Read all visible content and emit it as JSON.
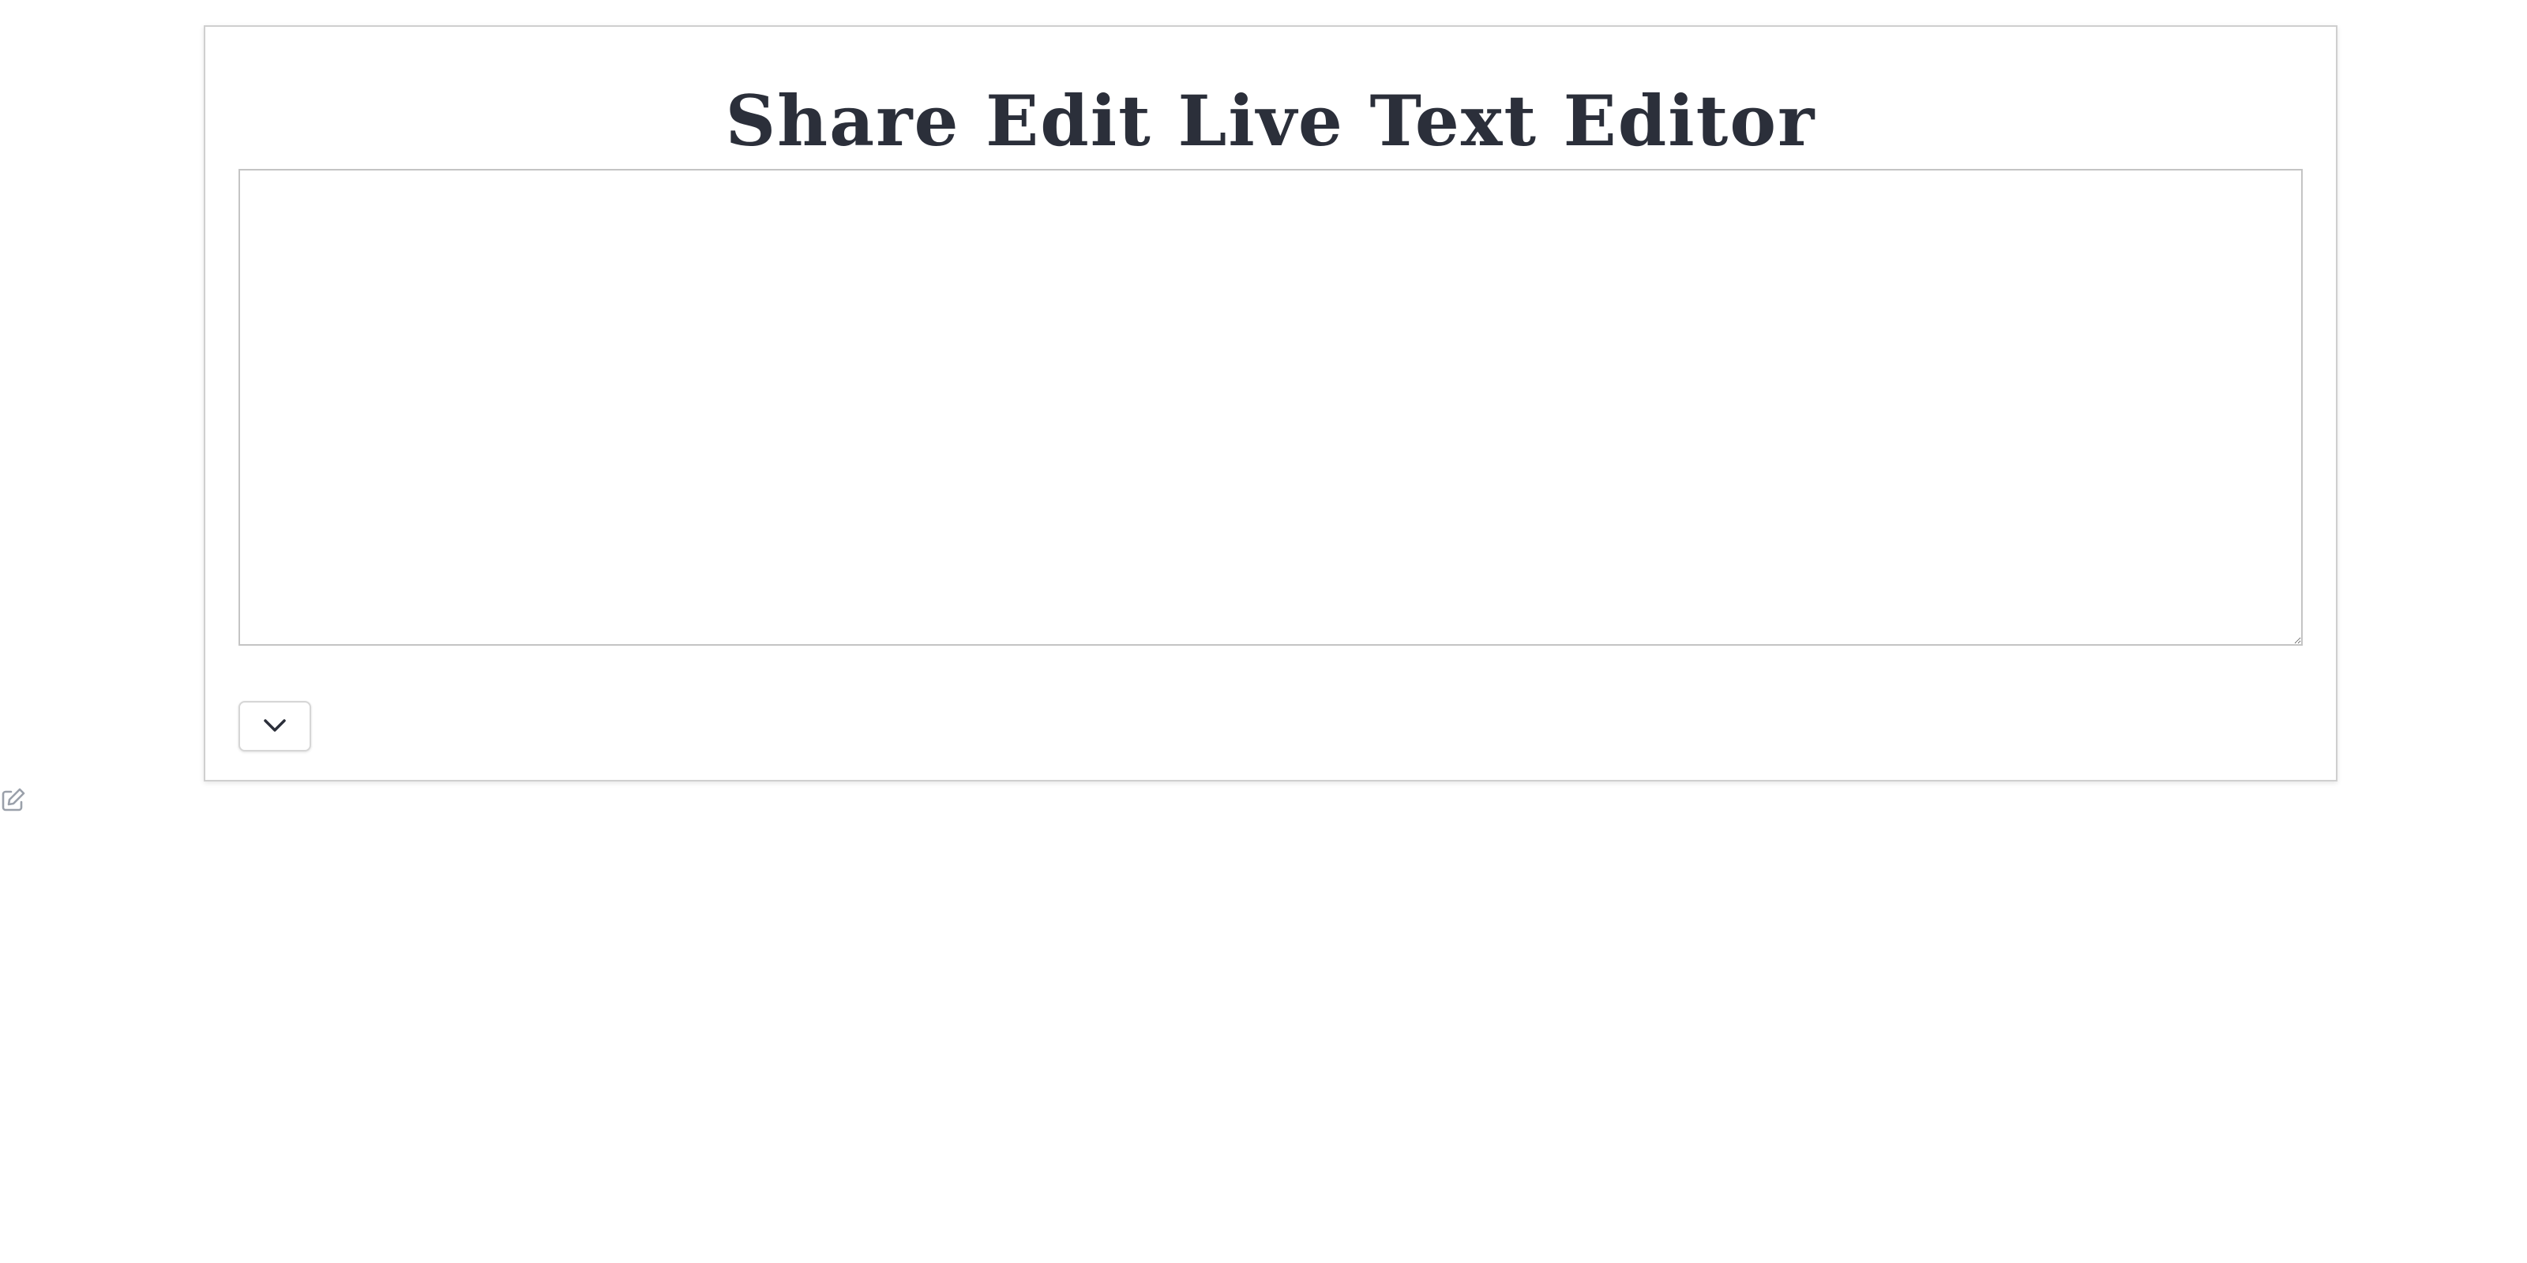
{
  "header": {
    "title": "Share Edit Live Text Editor"
  },
  "editor": {
    "value": "",
    "placeholder": ""
  },
  "controls": {
    "toggle_icon": "chevron-down-icon"
  },
  "side": {
    "icon": "edit-icon"
  },
  "colors": {
    "title": "#2b2f3a",
    "border": "#c4c4c4",
    "icon_muted": "#9aa0aa"
  }
}
